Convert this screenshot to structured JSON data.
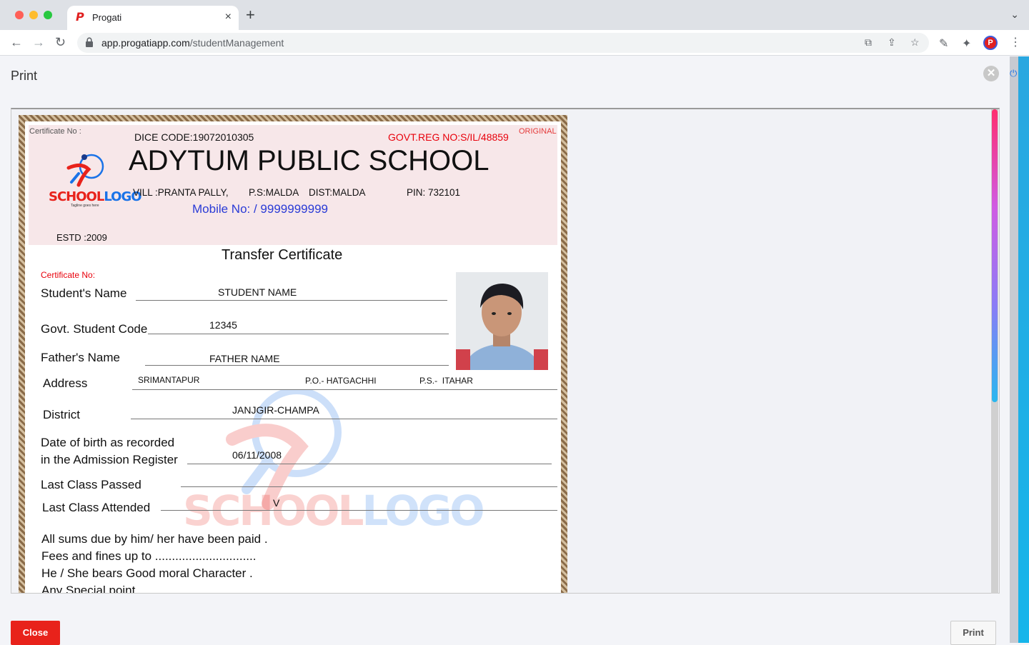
{
  "browser": {
    "tab_title": "Progati",
    "tab_close": "×",
    "new_tab": "+",
    "url_domain": "app.progatiapp.com",
    "url_path": "/studentManagement"
  },
  "modal": {
    "title": "Print",
    "close_x": "✕",
    "close_button": "Close",
    "print_button": "Print"
  },
  "certificate": {
    "certificate_no_top": "Certificate No :",
    "dice_code": "DICE CODE:19072010305",
    "govt_reg": "GOVT.REG NO:S/IL/48859",
    "original": "ORIGINAL",
    "school_name": "ADYTUM PUBLIC SCHOOL",
    "vill": "VILL :PRANTA PALLY,",
    "ps": "P.S:MALDA",
    "dist": "DIST:MALDA",
    "pin": "PIN: 732101",
    "mobile": "Mobile No: / 9999999999",
    "estd": "ESTD :2009",
    "logo_word1": "SCHOOL",
    "logo_word2": "LOGO",
    "logo_tagline": "Tagline goes here",
    "title": "Transfer Certificate",
    "certificate_no": "Certificate No:",
    "fields": {
      "student_name_label": "Student's Name",
      "student_name": "STUDENT NAME",
      "student_code_label": "Govt. Student Code",
      "student_code": "12345",
      "father_label": "Father's Name",
      "father": "FATHER NAME",
      "address_label": "Address",
      "address_village": "SRIMANTAPUR",
      "address_po": "P.O.- HATGACHHI",
      "address_ps": "P.S.-  ITAHAR",
      "district_label": "District",
      "district": "JANJGIR-CHAMPA",
      "dob_label_1": "Date of birth as recorded",
      "dob_label_2": "in the Admission Register",
      "dob": "06/11/2008",
      "last_passed_label": "Last Class Passed",
      "last_passed": "",
      "last_attended_label": "Last Class Attended",
      "last_attended": "V"
    },
    "statements": [
      "All sums due by him/ her have been paid .",
      "Fees and fines up to ..............................",
      "He / She bears Good moral Character .",
      "Any Special point"
    ]
  }
}
